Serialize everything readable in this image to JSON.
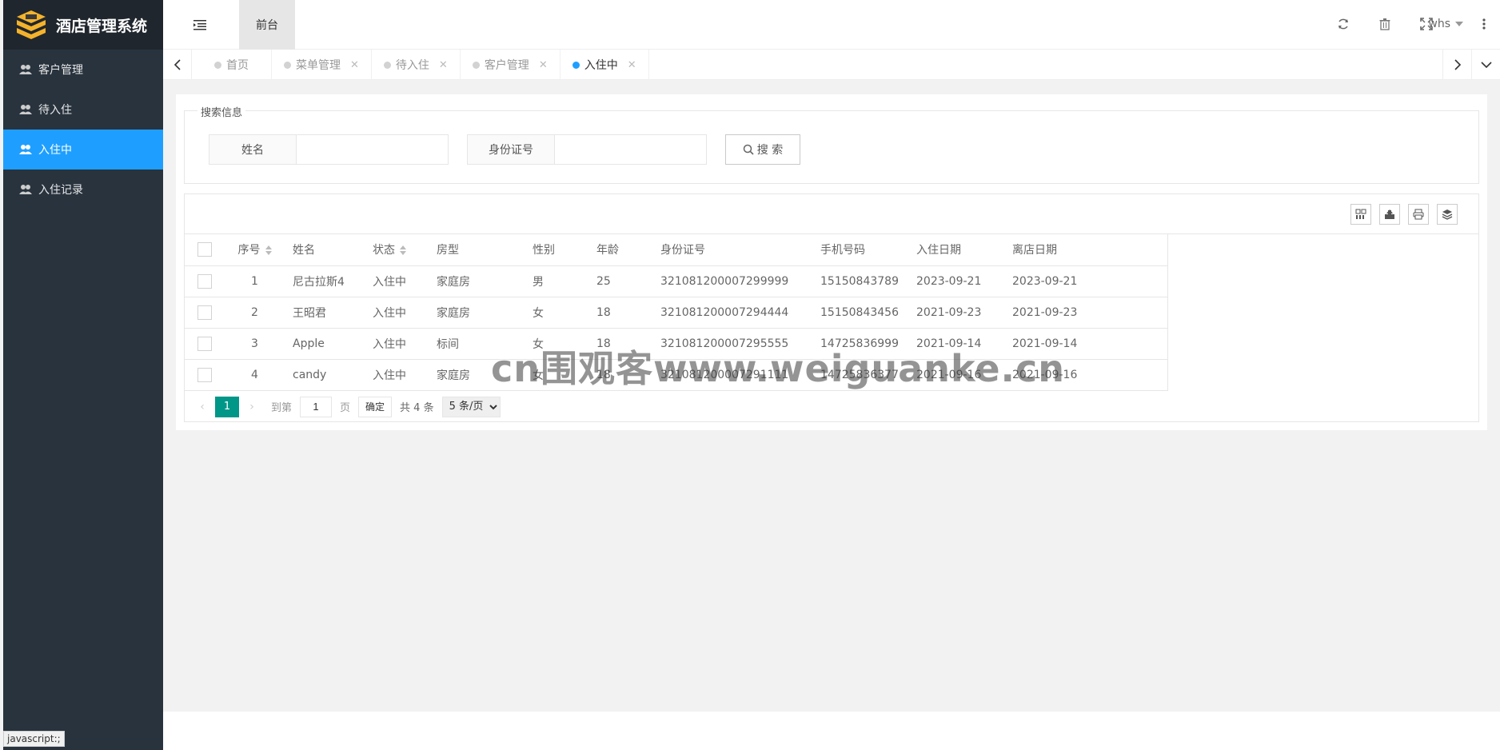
{
  "app": {
    "title": "酒店管理系统"
  },
  "sidebar": {
    "items": [
      {
        "label": "客户管理"
      },
      {
        "label": "待入住"
      },
      {
        "label": "入住中"
      },
      {
        "label": "入住记录"
      }
    ]
  },
  "header": {
    "front_tab": "前台",
    "user": "whs"
  },
  "tabs": [
    {
      "label": "首页"
    },
    {
      "label": "菜单管理"
    },
    {
      "label": "待入住"
    },
    {
      "label": "客户管理"
    },
    {
      "label": "入住中"
    }
  ],
  "search": {
    "legend": "搜索信息",
    "name_label": "姓名",
    "id_label": "身份证号",
    "button_label": "搜 索"
  },
  "table": {
    "columns": [
      "序号",
      "姓名",
      "状态",
      "房型",
      "性别",
      "年龄",
      "身份证号",
      "手机号码",
      "入住日期",
      "离店日期"
    ],
    "rows": [
      {
        "idx": "1",
        "name": "尼古拉斯4",
        "status": "入住中",
        "room": "家庭房",
        "gender": "男",
        "age": "25",
        "idcard": "321081200007299999",
        "phone": "15150843789",
        "checkin": "2023-09-21",
        "checkout": "2023-09-21"
      },
      {
        "idx": "2",
        "name": "王昭君",
        "status": "入住中",
        "room": "家庭房",
        "gender": "女",
        "age": "18",
        "idcard": "321081200007294444",
        "phone": "15150843456",
        "checkin": "2021-09-23",
        "checkout": "2021-09-23"
      },
      {
        "idx": "3",
        "name": "Apple",
        "status": "入住中",
        "room": "标间",
        "gender": "女",
        "age": "18",
        "idcard": "321081200007295555",
        "phone": "14725836999",
        "checkin": "2021-09-14",
        "checkout": "2021-09-14"
      },
      {
        "idx": "4",
        "name": "candy",
        "status": "入住中",
        "room": "家庭房",
        "gender": "女",
        "age": "18",
        "idcard": "321081200007291111",
        "phone": "14725836377",
        "checkin": "2021-09-16",
        "checkout": "2021-09-16"
      }
    ]
  },
  "pager": {
    "current": "1",
    "goto_label": "到第",
    "goto_value": "1",
    "page_unit": "页",
    "confirm": "确定",
    "total": "共 4 条",
    "page_size": "5 条/页"
  },
  "status_tip": "javascript:;",
  "watermark": "cn围观客www.weiguanke.cn",
  "colors": {
    "accent": "#1e9fff",
    "sidebar": "#28333e",
    "pager_active": "#009688"
  }
}
